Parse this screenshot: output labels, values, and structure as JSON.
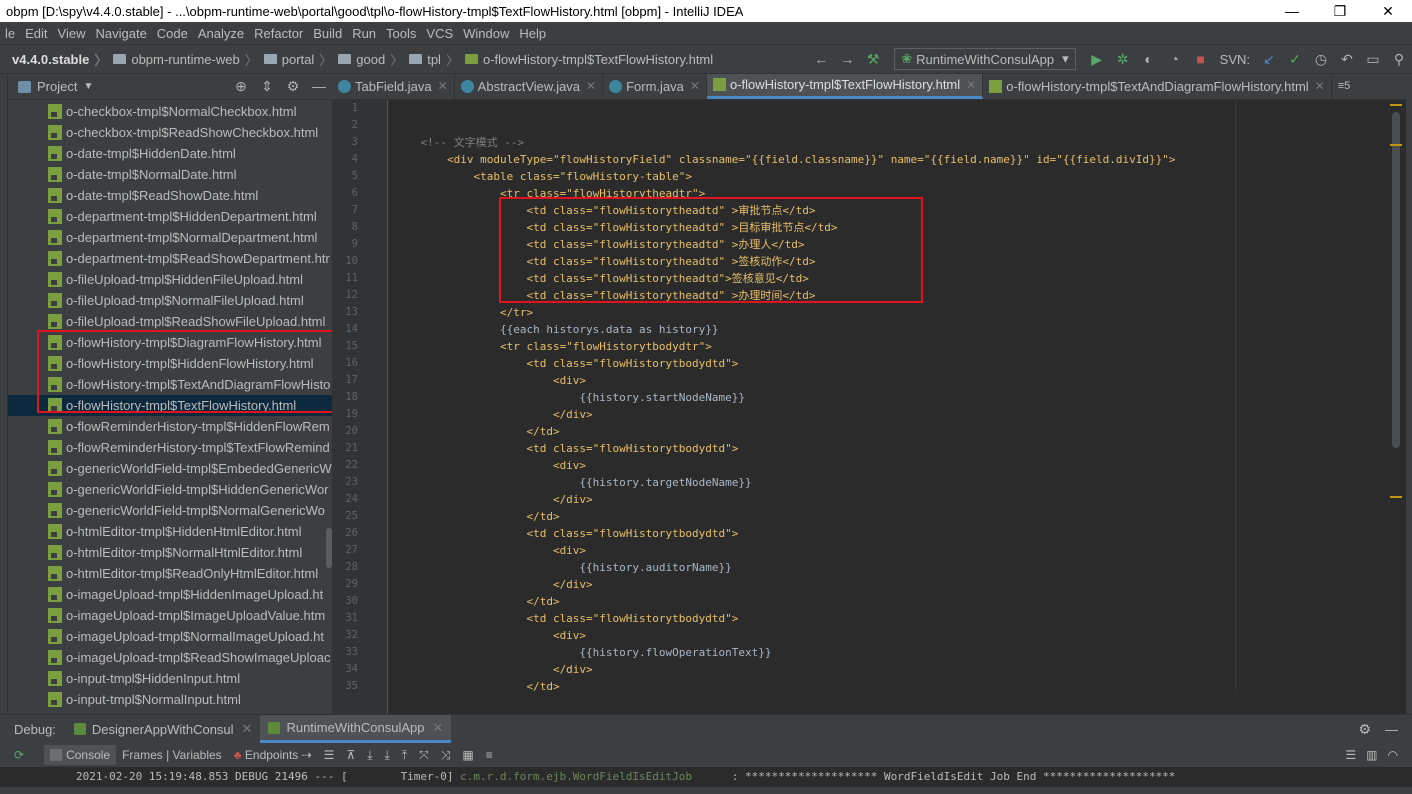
{
  "window": {
    "title": "obpm [D:\\spy\\v4.4.0.stable] - ...\\obpm-runtime-web\\portal\\good\\tpl\\o-flowHistory-tmpl$TextFlowHistory.html [obpm] - IntelliJ IDEA",
    "min": "—",
    "max": "❐",
    "close": "✕"
  },
  "menu": [
    "le",
    "Edit",
    "View",
    "Navigate",
    "Code",
    "Analyze",
    "Refactor",
    "Build",
    "Run",
    "Tools",
    "VCS",
    "Window",
    "Help"
  ],
  "breadcrumb": [
    "v4.4.0.stable",
    "obpm-runtime-web",
    "portal",
    "good",
    "tpl",
    "o-flowHistory-tmpl$TextFlowHistory.html"
  ],
  "toolbar": {
    "run_config": "RuntimeWithConsulApp",
    "svn": "SVN:"
  },
  "project": {
    "title": "Project",
    "files": [
      "o-checkbox-tmpl$NormalCheckbox.html",
      "o-checkbox-tmpl$ReadShowCheckbox.html",
      "o-date-tmpl$HiddenDate.html",
      "o-date-tmpl$NormalDate.html",
      "o-date-tmpl$ReadShowDate.html",
      "o-department-tmpl$HiddenDepartment.html",
      "o-department-tmpl$NormalDepartment.html",
      "o-department-tmpl$ReadShowDepartment.htr",
      "o-fileUpload-tmpl$HiddenFileUpload.html",
      "o-fileUpload-tmpl$NormalFileUpload.html",
      "o-fileUpload-tmpl$ReadShowFileUpload.html",
      "o-flowHistory-tmpl$DiagramFlowHistory.html",
      "o-flowHistory-tmpl$HiddenFlowHistory.html",
      "o-flowHistory-tmpl$TextAndDiagramFlowHisto",
      "o-flowHistory-tmpl$TextFlowHistory.html",
      "o-flowReminderHistory-tmpl$HiddenFlowRem",
      "o-flowReminderHistory-tmpl$TextFlowRemind",
      "o-genericWorldField-tmpl$EmbededGenericW",
      "o-genericWorldField-tmpl$HiddenGenericWor",
      "o-genericWorldField-tmpl$NormalGenericWo",
      "o-htmlEditor-tmpl$HiddenHtmlEditor.html",
      "o-htmlEditor-tmpl$NormalHtmlEditor.html",
      "o-htmlEditor-tmpl$ReadOnlyHtmlEditor.html",
      "o-imageUpload-tmpl$HiddenImageUpload.ht",
      "o-imageUpload-tmpl$ImageUploadValue.htm",
      "o-imageUpload-tmpl$NormalImageUpload.ht",
      "o-imageUpload-tmpl$ReadShowImageUploac",
      "o-input-tmpl$HiddenInput.html",
      "o-input-tmpl$NormalInput.html"
    ],
    "selected": "o-flowHistory-tmpl$TextFlowHistory.html"
  },
  "tabs": [
    "TabField.java",
    "AbstractView.java",
    "Form.java",
    "o-flowHistory-tmpl$TextFlowHistory.html",
    "o-flowHistory-tmpl$TextAndDiagramFlowHistory.html"
  ],
  "tab_overflow": "≡5",
  "line_numbers": [
    "1",
    "2",
    "3",
    "4",
    "5",
    "6",
    "7",
    "8",
    "9",
    "10",
    "11",
    "12",
    "13",
    "14",
    "15",
    "16",
    "17",
    "18",
    "19",
    "20",
    "21",
    "22",
    "23",
    "24",
    "25",
    "26",
    "27",
    "28",
    "29",
    "30",
    "31",
    "32",
    "33",
    "34",
    "35"
  ],
  "code_lines": [
    "",
    "",
    "    <!-- 文字模式 -->",
    "        <div moduleType=\"flowHistoryField\" classname=\"{{field.classname}}\" name=\"{{field.name}}\" id=\"{{field.divId}}\">",
    "            <table class=\"flowHistory-table\">",
    "                <tr class=\"flowHistorytheadtr\">",
    "                    <td class=\"flowHistorytheadtd\" >审批节点</td>",
    "                    <td class=\"flowHistorytheadtd\" >目标审批节点</td>",
    "                    <td class=\"flowHistorytheadtd\" >办理人</td>",
    "                    <td class=\"flowHistorytheadtd\" >签核动作</td>",
    "                    <td class=\"flowHistorytheadtd\">签核意见</td>",
    "                    <td class=\"flowHistorytheadtd\" >办理时间</td>",
    "                </tr>",
    "                {{each historys.data as history}}",
    "                <tr class=\"flowHistorytbodydtr\">",
    "                    <td class=\"flowHistorytbodydtd\">",
    "                        <div>",
    "                            {{history.startNodeName}}",
    "                        </div>",
    "                    </td>",
    "                    <td class=\"flowHistorytbodydtd\">",
    "                        <div>",
    "                            {{history.targetNodeName}}",
    "                        </div>",
    "                    </td>",
    "                    <td class=\"flowHistorytbodydtd\">",
    "                        <div>",
    "                            {{history.auditorName}}",
    "                        </div>",
    "                    </td>",
    "                    <td class=\"flowHistorytbodydtd\">",
    "                        <div>",
    "                            {{history.flowOperationText}}",
    "                        </div>",
    "                    </td>"
  ],
  "debug": {
    "label": "Debug:",
    "tabs": [
      "DesignerAppWithConsul",
      "RuntimeWithConsulApp"
    ],
    "console": "Console",
    "frames": "Frames | Variables",
    "endpoints": "Endpoints",
    "log_time": "2021-02-20 15:19:48.853",
    "log_level": "DEBUG",
    "log_pid": "21496",
    "log_sep": "--- [",
    "log_thread": "Timer-0]",
    "log_class": "c.m.r.d.form.ejb.WordFieldIsEditJob",
    "log_msg": ": ******************** WordFieldIsEdit Job End ********************"
  },
  "colors": {
    "highlight_box": "#e0141e",
    "selection": "#0d293e",
    "tab_active_underline": "#4a88c7"
  }
}
